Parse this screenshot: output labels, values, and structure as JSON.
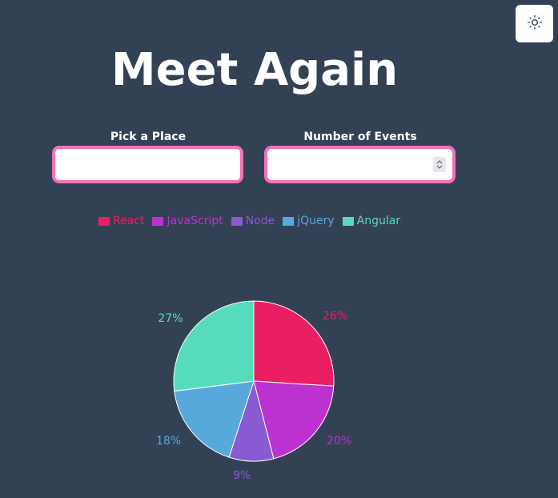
{
  "app": {
    "title": "Meet Again"
  },
  "theme_toggle": {
    "icon": "sun-icon"
  },
  "filters": {
    "place": {
      "label": "Pick a Place",
      "value": "",
      "placeholder": ""
    },
    "events": {
      "label": "Number of Events",
      "value": "",
      "placeholder": ""
    }
  },
  "colors": {
    "background": "#334155",
    "input_border": "#f472b6"
  },
  "chart_data": {
    "type": "pie",
    "series": [
      {
        "name": "React",
        "value": 26,
        "label": "26%",
        "color": "#ea1e63"
      },
      {
        "name": "JavaScript",
        "value": 20,
        "label": "20%",
        "color": "#bc32d0"
      },
      {
        "name": "Node",
        "value": 9,
        "label": "9%",
        "color": "#8a5ad2"
      },
      {
        "name": "jQuery",
        "value": 18,
        "label": "18%",
        "color": "#58a9db"
      },
      {
        "name": "Angular",
        "value": 27,
        "label": "27%",
        "color": "#56dcbd"
      }
    ],
    "legend": "top"
  }
}
